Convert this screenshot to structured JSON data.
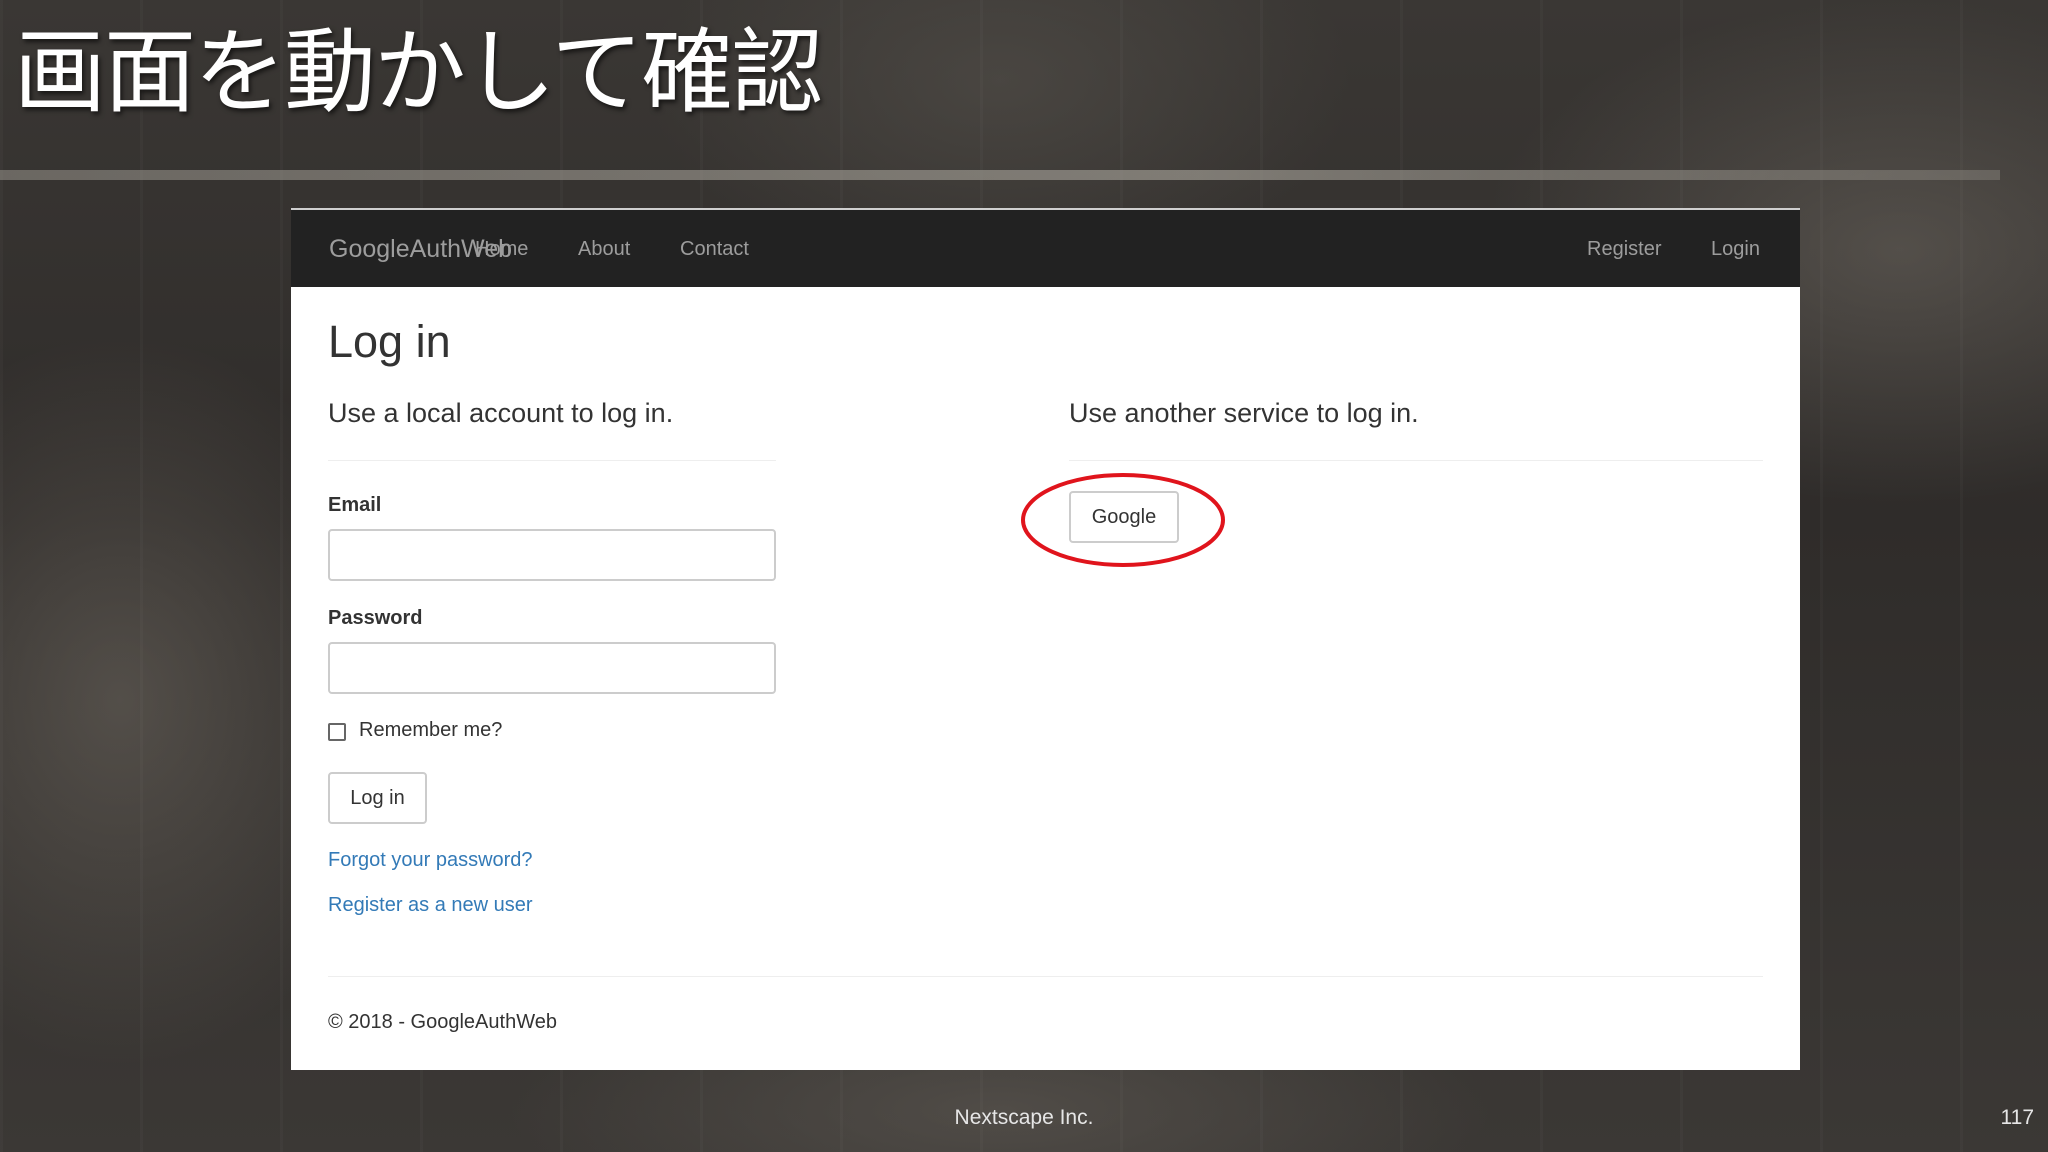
{
  "slide": {
    "title": "画面を動かして確認",
    "footer_company": "Nextscape Inc.",
    "page_number": "117"
  },
  "navbar": {
    "brand": "GoogleAuthWeb",
    "links": [
      "Home",
      "About",
      "Contact"
    ],
    "right_links": [
      "Register",
      "Login"
    ]
  },
  "login_page": {
    "heading": "Log in",
    "local_heading": "Use a local account to log in.",
    "external_heading": "Use another service to log in.",
    "email_label": "Email",
    "email_value": "",
    "password_label": "Password",
    "password_value": "",
    "remember_label": "Remember me?",
    "remember_checked": false,
    "login_button": "Log in",
    "forgot_link": "Forgot your password?",
    "register_link": "Register as a new user",
    "google_button": "Google",
    "footer": "© 2018 - GoogleAuthWeb"
  },
  "colors": {
    "navbar_bg": "#222222",
    "nav_text": "#9d9d9d",
    "link": "#337ab7",
    "highlight_circle": "#e0141c"
  }
}
